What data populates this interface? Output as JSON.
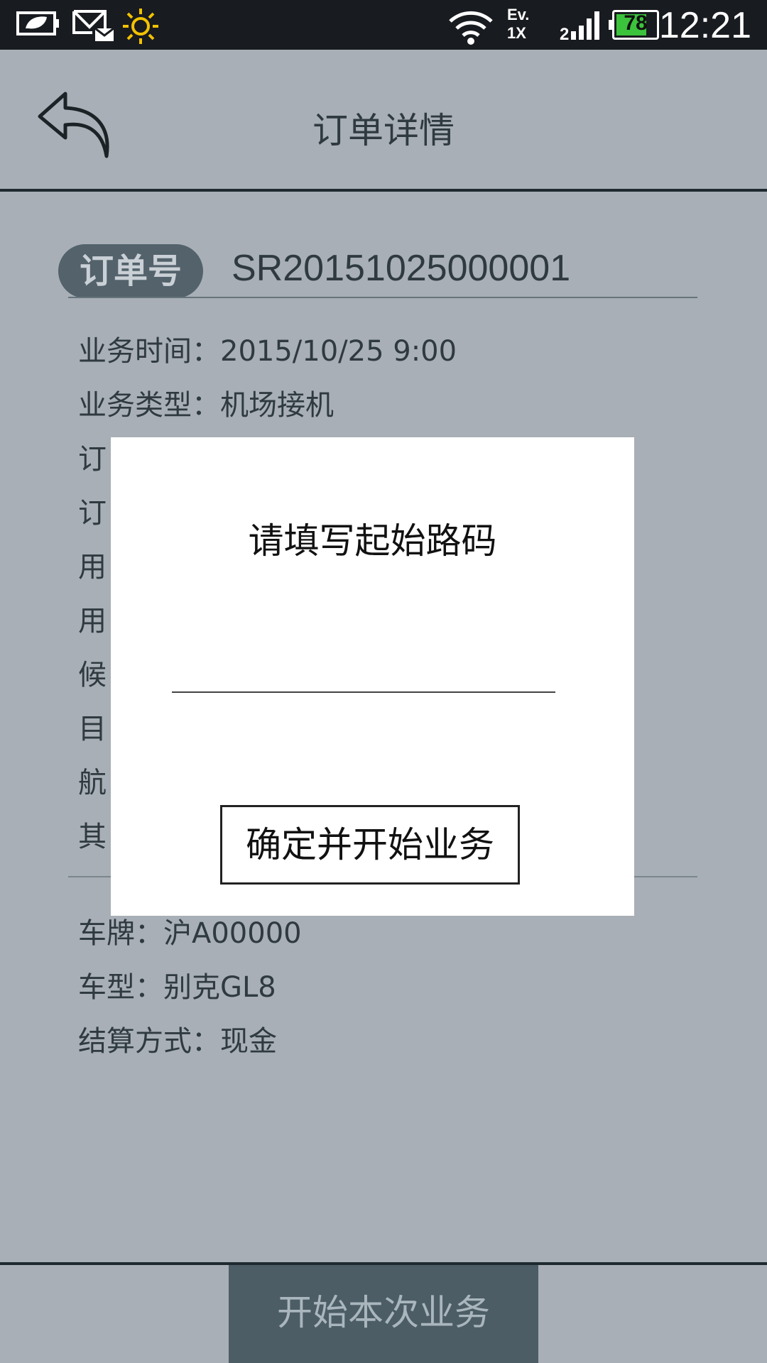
{
  "status_bar": {
    "time": "12:21",
    "battery": "78",
    "battery_level_percent": 78,
    "network_labels": [
      "Ev.",
      "1X"
    ],
    "icons": [
      "battery-saver-icon",
      "mail-icon",
      "brightness-icon",
      "wifi-icon",
      "signal-icon",
      "battery-icon"
    ]
  },
  "header": {
    "title": "订单详情",
    "back_icon": "back-arrow-icon"
  },
  "order": {
    "badge": "订单号",
    "number": "SR20151025000001"
  },
  "details": [
    {
      "text": "业务时间：2015/10/25  9:00"
    },
    {
      "text": "业务类型：机场接机"
    },
    {
      "text": "订"
    },
    {
      "text": "订"
    },
    {
      "text": "用"
    },
    {
      "text": "用"
    },
    {
      "text": "候"
    },
    {
      "text": "目"
    },
    {
      "text": "航"
    },
    {
      "text": "其"
    }
  ],
  "vehicle": [
    {
      "text": "车牌：沪A00000"
    },
    {
      "text": "车型：别克GL8"
    },
    {
      "text": "结算方式：现金"
    }
  ],
  "bottom": {
    "start_label": "开始本次业务"
  },
  "dialog": {
    "title": "请填写起始路码",
    "input_value": "",
    "confirm_label": "确定并开始业务"
  },
  "colors": {
    "background": "#a8afb6",
    "badge": "#53626b",
    "start_button": "#4c5d66",
    "battery_fill": "#3cc33c"
  }
}
